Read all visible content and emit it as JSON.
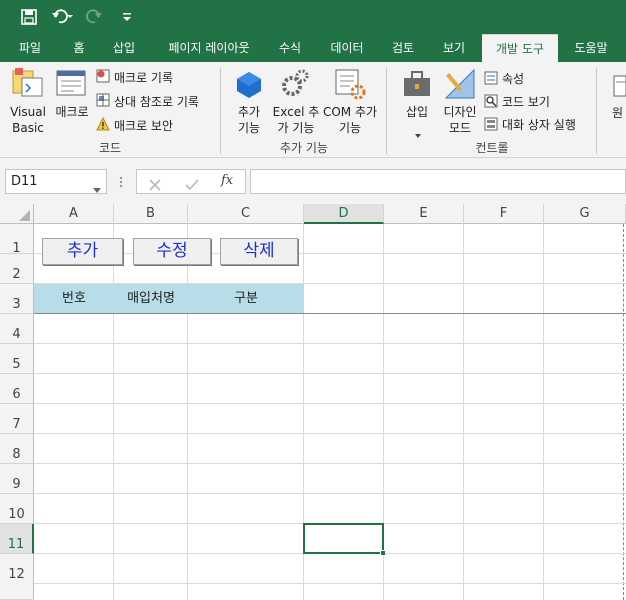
{
  "ribbon_tabs": [
    "파일",
    "홈",
    "삽입",
    "페이지 레이아웃",
    "수식",
    "데이터",
    "검토",
    "보기",
    "개발 도구",
    "도움말"
  ],
  "active_tab": "개발 도구",
  "ribbon": {
    "code": {
      "visual_basic": "Visual Basic",
      "macro": "매크로",
      "record_macro": "매크로 기록",
      "relative_ref": "상대 참조로 기록",
      "macro_security": "매크로 보안",
      "label": "코드"
    },
    "addins": {
      "addins": "추가 기능",
      "excel_addins": "Excel 추가 기능",
      "com_addins": "COM 추가 기능",
      "label": "추가 기능"
    },
    "controls": {
      "insert": "삽입",
      "design_mode": "디자인 모드",
      "properties": "속성",
      "view_code": "코드 보기",
      "run_dialog": "대화 상자 실행",
      "label": "컨트롤"
    },
    "source_partial": "원"
  },
  "formula_bar": {
    "name_box": "D11",
    "formula": ""
  },
  "columns": [
    "A",
    "B",
    "C",
    "D",
    "E",
    "F",
    "G"
  ],
  "rows": [
    "1",
    "2",
    "3",
    "4",
    "5",
    "6",
    "7",
    "8",
    "9",
    "10",
    "11",
    "12"
  ],
  "selected_column": "D",
  "selected_row": "11",
  "sheet_buttons": {
    "add": "추가",
    "edit": "수정",
    "delete": "삭제"
  },
  "table_headers": [
    "번호",
    "매입처명",
    "구분"
  ],
  "colors": {
    "accent": "#217346",
    "header_fill": "#b7dde8",
    "button_text": "#1a2fd6"
  }
}
